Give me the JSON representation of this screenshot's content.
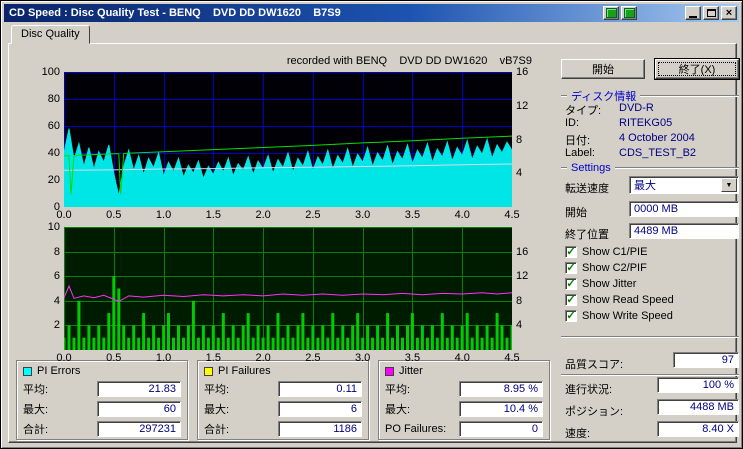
{
  "window": {
    "title": "CD Speed : Disc Quality Test - BENQ    DVD DD DW1620    B7S9"
  },
  "tab": {
    "label": "Disc Quality"
  },
  "chart_header": "recorded with BENQ    DVD DD DW1620    vB7S9",
  "chart_data": [
    {
      "name": "pie-speed-chart",
      "type": "area",
      "x_min": 0,
      "x_max": 4.5,
      "x_unit": "GB",
      "x_ticks": [
        0,
        0.5,
        1,
        1.5,
        2,
        2.5,
        3,
        3.5,
        4,
        4.5
      ],
      "left_axis": {
        "min": 0,
        "max": 100,
        "ticks": [
          0,
          20,
          40,
          60,
          80,
          100
        ]
      },
      "right_axis": {
        "min": 0,
        "max": 16,
        "ticks": [
          4,
          8,
          12,
          16
        ]
      },
      "bg": "#000006",
      "grid": "#0000c8",
      "series": [
        {
          "name": "PI Errors (C1/PIE)",
          "style": "area",
          "axis": "left",
          "color": "#00e5e5",
          "x_step": 0.05,
          "values": [
            40,
            58,
            35,
            47,
            30,
            44,
            28,
            41,
            33,
            46,
            25,
            8,
            30,
            42,
            27,
            38,
            24,
            36,
            29,
            40,
            23,
            33,
            26,
            36,
            22,
            31,
            25,
            34,
            21,
            30,
            24,
            33,
            26,
            36,
            23,
            32,
            27,
            37,
            24,
            34,
            28,
            38,
            25,
            35,
            29,
            40,
            26,
            36,
            30,
            41,
            27,
            37,
            31,
            42,
            28,
            38,
            32,
            43,
            29,
            39,
            33,
            44,
            30,
            40,
            34,
            45,
            31,
            41,
            35,
            46,
            32,
            42,
            36,
            47,
            33,
            43,
            37,
            48,
            34,
            44,
            38,
            49,
            35,
            45,
            39,
            50,
            36,
            46,
            40,
            48,
            42
          ]
        },
        {
          "name": "Read Speed",
          "style": "line",
          "axis": "right",
          "color": "#d8d8f0",
          "points": [
            [
              0,
              4.35
            ],
            [
              0.5,
              4.4
            ],
            [
              1,
              4.5
            ],
            [
              1.5,
              4.55
            ],
            [
              2,
              4.65
            ],
            [
              2.5,
              4.7
            ],
            [
              3,
              4.8
            ],
            [
              3.5,
              4.9
            ],
            [
              4,
              5
            ],
            [
              4.5,
              5.1
            ]
          ]
        },
        {
          "name": "Write Speed",
          "style": "line",
          "axis": "right",
          "color": "#00e000",
          "points": [
            [
              0,
              6.05
            ],
            [
              0.05,
              6.1
            ],
            [
              0.07,
              1.5
            ],
            [
              0.1,
              6.1
            ],
            [
              0.5,
              6.3
            ],
            [
              0.55,
              6.32
            ],
            [
              0.57,
              1.5
            ],
            [
              0.6,
              6.35
            ],
            [
              1,
              6.55
            ],
            [
              1.5,
              6.8
            ],
            [
              2,
              7.05
            ],
            [
              2.5,
              7.3
            ],
            [
              3,
              7.6
            ],
            [
              3.5,
              7.85
            ],
            [
              4,
              8.15
            ],
            [
              4.5,
              8.4
            ]
          ]
        }
      ]
    },
    {
      "name": "pif-jitter-chart",
      "type": "bar",
      "x_min": 0,
      "x_max": 4.5,
      "x_unit": "GB",
      "x_ticks": [
        0,
        0.5,
        1,
        1.5,
        2,
        2.5,
        3,
        3.5,
        4,
        4.5
      ],
      "left_axis": {
        "min": 0,
        "max": 10,
        "ticks": [
          2,
          4,
          6,
          8,
          10
        ]
      },
      "right_axis": {
        "min": 0,
        "max": 20,
        "ticks": [
          4,
          8,
          12,
          16
        ]
      },
      "bg": "#001c00",
      "grid": "#0a800a",
      "series": [
        {
          "name": "PI Failures (C2/PIF)",
          "style": "bars",
          "axis": "left",
          "color": "#00cc00",
          "x_step": 0.05,
          "values": [
            1,
            2,
            1,
            4,
            1,
            2,
            1,
            2,
            1,
            3,
            6,
            5,
            2,
            1,
            2,
            1,
            3,
            1,
            2,
            1,
            2,
            3,
            1,
            2,
            1,
            2,
            4,
            1,
            2,
            1,
            2,
            1,
            3,
            1,
            2,
            1,
            2,
            3,
            1,
            2,
            1,
            2,
            1,
            3,
            1,
            2,
            1,
            2,
            3,
            1,
            2,
            1,
            2,
            1,
            3,
            1,
            2,
            1,
            2,
            3,
            1,
            2,
            1,
            2,
            1,
            3,
            1,
            2,
            1,
            2,
            3,
            1,
            2,
            1,
            2,
            1,
            3,
            1,
            2,
            1,
            2,
            3,
            1,
            2,
            1,
            2,
            1,
            3,
            2,
            1,
            2
          ]
        },
        {
          "name": "Jitter",
          "style": "line",
          "axis": "right",
          "color": "#ff30ff",
          "points": [
            [
              0,
              8.5
            ],
            [
              0.05,
              10.4
            ],
            [
              0.1,
              8.4
            ],
            [
              0.2,
              8.8
            ],
            [
              0.3,
              8.5
            ],
            [
              0.4,
              8.9
            ],
            [
              0.55,
              7.9
            ],
            [
              0.65,
              8.8
            ],
            [
              0.8,
              8.6
            ],
            [
              1,
              8.9
            ],
            [
              1.2,
              8.7
            ],
            [
              1.4,
              9
            ],
            [
              1.6,
              8.8
            ],
            [
              1.8,
              9
            ],
            [
              2,
              8.8
            ],
            [
              2.2,
              9.1
            ],
            [
              2.4,
              8.9
            ],
            [
              2.6,
              9.1
            ],
            [
              2.8,
              8.9
            ],
            [
              3,
              9.1
            ],
            [
              3.2,
              9
            ],
            [
              3.4,
              9.2
            ],
            [
              3.6,
              9
            ],
            [
              3.8,
              9.2
            ],
            [
              4,
              9.1
            ],
            [
              4.2,
              9.3
            ],
            [
              4.35,
              9.1
            ],
            [
              4.5,
              9.3
            ]
          ]
        }
      ]
    }
  ],
  "legend": [
    {
      "title": "PI Errors",
      "color": "#00ffff",
      "rows": [
        {
          "label": "平均:",
          "value": "21.83"
        },
        {
          "label": "最大:",
          "value": "60"
        },
        {
          "label": "合計:",
          "value": "297231"
        }
      ]
    },
    {
      "title": "PI Failures",
      "color": "#ffff00",
      "rows": [
        {
          "label": "平均:",
          "value": "0.11"
        },
        {
          "label": "最大:",
          "value": "6"
        },
        {
          "label": "合計:",
          "value": "1186"
        }
      ]
    },
    {
      "title": "Jitter",
      "color": "#ff00ff",
      "rows": [
        {
          "label": "平均:",
          "value": "8.95 %"
        },
        {
          "label": "最大:",
          "value": "10.4 %"
        },
        {
          "label": "PO Failures:",
          "value": "0"
        }
      ]
    }
  ],
  "sidebar": {
    "start_button": "開始",
    "exit_button": "終了(X)",
    "disc_info_heading": "ディスク情報",
    "disc_info": [
      {
        "label": "タイプ:",
        "value": "DVD-R"
      },
      {
        "label": "ID:",
        "value": "RITEKG05"
      },
      {
        "label": "日付:",
        "value": "4 October 2004"
      },
      {
        "label": "Label:",
        "value": "CDS_TEST_B2"
      }
    ],
    "settings_heading": "Settings",
    "speed_label": "転送速度",
    "speed_value": "最大",
    "start_label": "開始",
    "start_value": "0000 MB",
    "end_label": "終了位置",
    "end_value": "4489 MB",
    "checkboxes": [
      {
        "label": "Show C1/PIE",
        "checked": true
      },
      {
        "label": "Show C2/PIF",
        "checked": true
      },
      {
        "label": "Show Jitter",
        "checked": true
      },
      {
        "label": "Show Read Speed",
        "checked": true
      },
      {
        "label": "Show Write Speed",
        "checked": true
      }
    ],
    "score_label": "品質スコア:",
    "score_value": "97",
    "status": [
      {
        "label": "進行状況:",
        "value": "100 %"
      },
      {
        "label": "ポジション:",
        "value": "4488 MB"
      },
      {
        "label": "速度:",
        "value": "8.40 X"
      }
    ]
  }
}
